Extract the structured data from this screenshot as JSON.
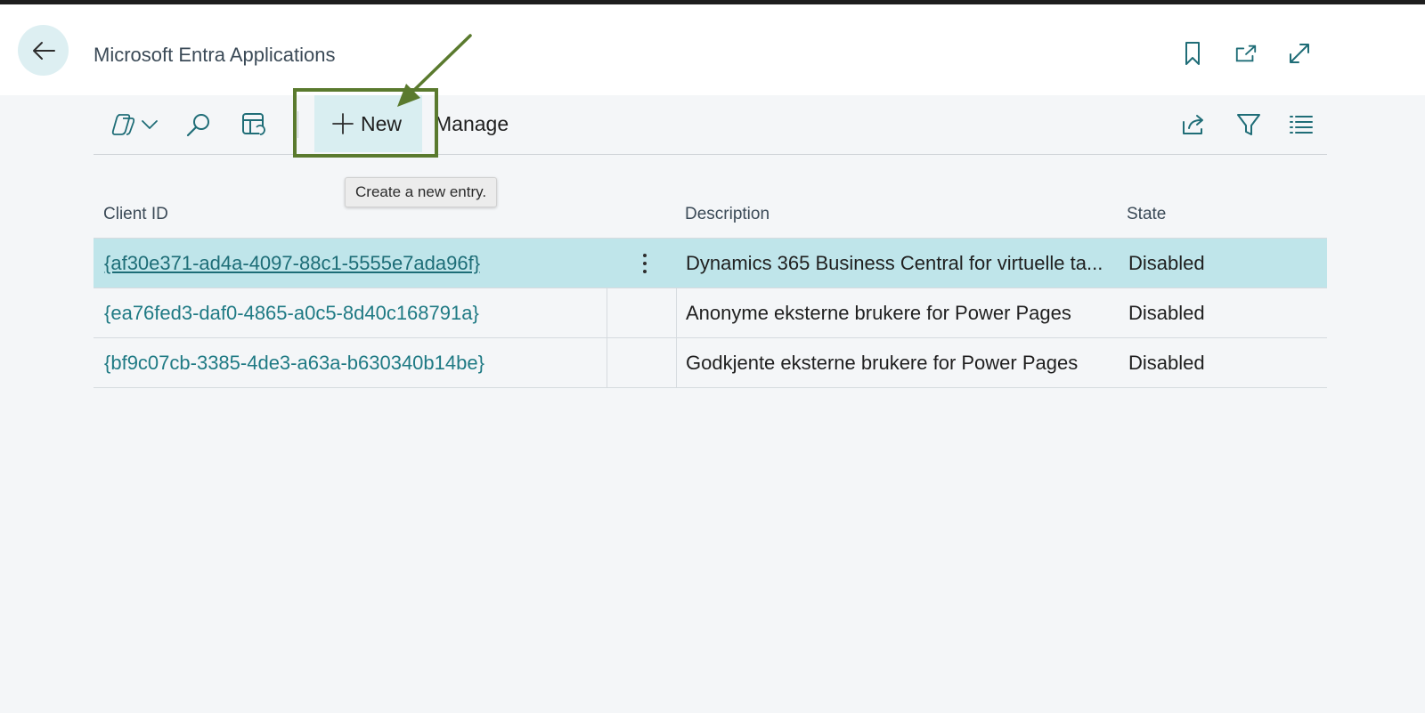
{
  "header": {
    "title": "Microsoft Entra Applications"
  },
  "toolbar": {
    "new_label": "New",
    "manage_label": "Manage",
    "tooltip": "Create a new entry."
  },
  "table": {
    "columns": {
      "client_id": "Client ID",
      "description": "Description",
      "state": "State"
    },
    "rows": [
      {
        "client_id": "{af30e371-ad4a-4097-88c1-5555e7ada96f}",
        "description": "Dynamics 365 Business Central for virtuelle ta...",
        "state": "Disabled"
      },
      {
        "client_id": "{ea76fed3-daf0-4865-a0c5-8d40c168791a}",
        "description": "Anonyme eksterne brukere for Power Pages",
        "state": "Disabled"
      },
      {
        "client_id": "{bf9c07cb-3385-4de3-a63a-b630340b14be}",
        "description": "Godkjente eksterne brukere for Power Pages",
        "state": "Disabled"
      }
    ]
  },
  "colors": {
    "accent": "#1f7a84",
    "selected_row": "#bfe5ea",
    "annotation": "#5a7a2e"
  }
}
